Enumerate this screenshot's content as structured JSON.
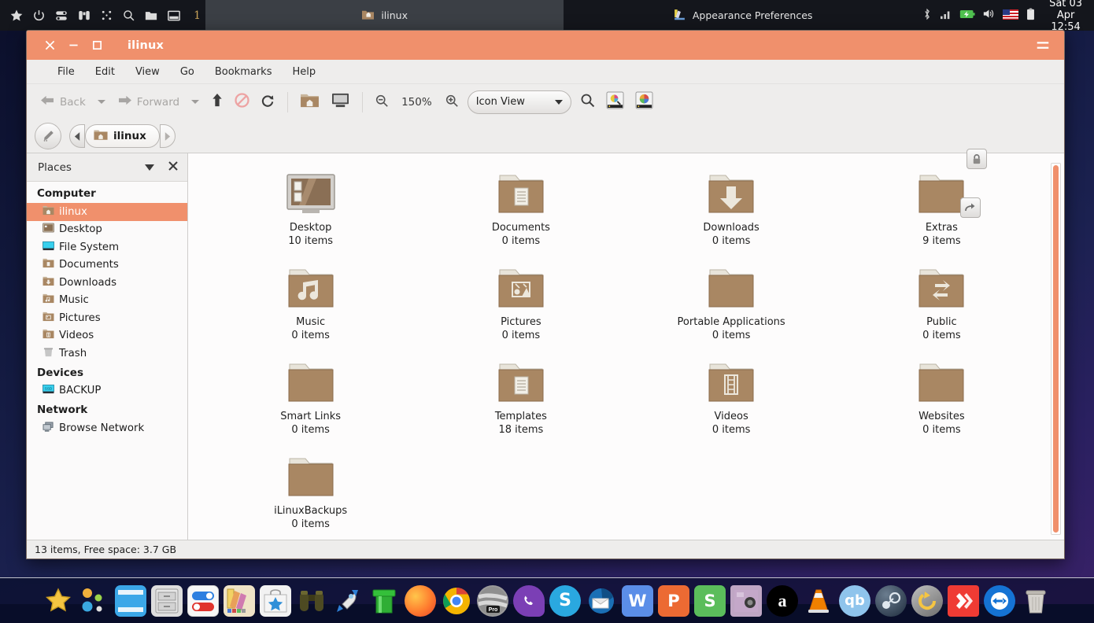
{
  "panel": {
    "launcher_icons": [
      "star-icon",
      "power-icon",
      "switch-user-icon",
      "binoculars-icon",
      "apps-grid-icon",
      "search-icon",
      "folder-icon",
      "window-icon"
    ],
    "workspace": "1",
    "tasks": [
      {
        "label": "ilinux",
        "icon": "home-folder-icon",
        "active": true
      },
      {
        "label": "Appearance Preferences",
        "icon": "appearance-icon",
        "active": false
      }
    ],
    "tray_icons": [
      "bluetooth-icon",
      "signal-icon",
      "battery-icon",
      "volume-icon",
      "flag-us-icon",
      "clipboard-icon"
    ],
    "clock_date": "Sat 03 Apr",
    "clock_time": "12:54"
  },
  "window": {
    "title": "ilinux",
    "close_label": "✕",
    "minimize_label": "—",
    "maximize_label": "□",
    "menu_button": "hamburger-menu-icon",
    "menubar": [
      "File",
      "Edit",
      "View",
      "Go",
      "Bookmarks",
      "Help"
    ],
    "toolbar": {
      "back_label": "Back",
      "forward_label": "Forward",
      "up_icon": "arrow-up-icon",
      "stop_icon": "stop-icon",
      "reload_icon": "reload-icon",
      "home_icon": "home-folder-icon",
      "computer_icon": "computer-icon",
      "zoom_out_icon": "zoom-out-icon",
      "zoom_level": "150%",
      "zoom_in_icon": "zoom-in-icon",
      "view_mode": "Icon View",
      "search_icon": "search-icon",
      "extra_icon_1": "image-search-icon",
      "extra_icon_2": "color-wheel-icon"
    },
    "pathbar": {
      "edit_icon": "pencil-path-icon",
      "prev_icon": "chevron-left-icon",
      "crumb_label": "ilinux",
      "crumb_icon": "home-folder-icon",
      "next_icon": "chevron-right-icon"
    },
    "statusbar": "13 items, Free space: 3.7 GB"
  },
  "sidebar": {
    "header": "Places",
    "header_caret": "chevron-down-icon",
    "header_close": "close-icon",
    "groups": [
      {
        "title": "Computer",
        "items": [
          {
            "label": "ilinux",
            "icon": "home-folder-icon",
            "selected": true
          },
          {
            "label": "Desktop",
            "icon": "desktop-icon",
            "selected": false
          },
          {
            "label": "File System",
            "icon": "drive-icon",
            "selected": false
          },
          {
            "label": "Documents",
            "icon": "documents-folder-icon",
            "selected": false
          },
          {
            "label": "Downloads",
            "icon": "downloads-folder-icon",
            "selected": false
          },
          {
            "label": "Music",
            "icon": "music-folder-icon",
            "selected": false
          },
          {
            "label": "Pictures",
            "icon": "pictures-folder-icon",
            "selected": false
          },
          {
            "label": "Videos",
            "icon": "videos-folder-icon",
            "selected": false
          },
          {
            "label": "Trash",
            "icon": "trash-icon",
            "selected": false
          }
        ]
      },
      {
        "title": "Devices",
        "items": [
          {
            "label": "BACKUP",
            "icon": "ssd-icon",
            "selected": false
          }
        ]
      },
      {
        "title": "Network",
        "items": [
          {
            "label": "Browse Network",
            "icon": "network-icon",
            "selected": false
          }
        ]
      }
    ]
  },
  "files": [
    {
      "name": "Desktop",
      "sub": "10 items",
      "icon": "desktop-monitor-icon",
      "glyph": "desktop",
      "badges": []
    },
    {
      "name": "Documents",
      "sub": "0 items",
      "icon": "documents-folder-icon",
      "glyph": "document",
      "badges": []
    },
    {
      "name": "Downloads",
      "sub": "0 items",
      "icon": "downloads-folder-icon",
      "glyph": "download",
      "badges": []
    },
    {
      "name": "Extras",
      "sub": "9 items",
      "icon": "folder-icon",
      "glyph": "none",
      "badges": [
        "lock-badge",
        "symlink-badge"
      ]
    },
    {
      "name": "Music",
      "sub": "0 items",
      "icon": "music-folder-icon",
      "glyph": "music",
      "badges": []
    },
    {
      "name": "Pictures",
      "sub": "0 items",
      "icon": "pictures-folder-icon",
      "glyph": "picture",
      "badges": []
    },
    {
      "name": "Portable Applications",
      "sub": "0 items",
      "icon": "folder-icon",
      "glyph": "none",
      "badges": []
    },
    {
      "name": "Public",
      "sub": "0 items",
      "icon": "public-folder-icon",
      "glyph": "sync",
      "badges": []
    },
    {
      "name": "Smart Links",
      "sub": "0 items",
      "icon": "folder-icon",
      "glyph": "none",
      "badges": []
    },
    {
      "name": "Templates",
      "sub": "18 items",
      "icon": "templates-folder-icon",
      "glyph": "document",
      "badges": []
    },
    {
      "name": "Videos",
      "sub": "0 items",
      "icon": "videos-folder-icon",
      "glyph": "film",
      "badges": []
    },
    {
      "name": "Websites",
      "sub": "0 items",
      "icon": "folder-icon",
      "glyph": "none",
      "badges": []
    },
    {
      "name": "iLinuxBackups",
      "sub": "0 items",
      "icon": "folder-icon",
      "glyph": "none",
      "badges": []
    }
  ],
  "dock": [
    {
      "name": "menu-launcher",
      "label": "★",
      "bg": "transparent",
      "fg": "#f5c542"
    },
    {
      "name": "app-grid",
      "label": "",
      "bg": "transparent",
      "fg": "#f5c542"
    },
    {
      "name": "file-browser",
      "label": "",
      "bg": "#3ba7e8",
      "fg": "#ffffff"
    },
    {
      "name": "file-cabinet",
      "label": "",
      "bg": "#d8d8d8",
      "fg": "#555555"
    },
    {
      "name": "settings-toggles",
      "label": "",
      "bg": "#f5f5f5",
      "fg": "#2d7fe0"
    },
    {
      "name": "color-palette",
      "label": "",
      "bg": "#ecd9a0",
      "fg": "#444444"
    },
    {
      "name": "software-store",
      "label": "★",
      "bg": "#f0f0f0",
      "fg": "#2f8fd8"
    },
    {
      "name": "binoculars-search",
      "label": "",
      "bg": "#4d4a22",
      "fg": "#c9c48a"
    },
    {
      "name": "rocket-launcher",
      "label": "",
      "bg": "transparent",
      "fg": "#3d8fd6"
    },
    {
      "name": "green-pipe",
      "label": "",
      "bg": "transparent",
      "fg": "#34c03a"
    },
    {
      "name": "firefox",
      "label": "",
      "bg": "#ff7b2e",
      "fg": "#ffffff"
    },
    {
      "name": "google-chrome",
      "label": "",
      "bg": "#ffffff",
      "fg": "#4285f4"
    },
    {
      "name": "opera-pro",
      "label": "Pro",
      "bg": "#9a9a9a",
      "fg": "#ffffff"
    },
    {
      "name": "viber",
      "label": "",
      "bg": "#7b3fb5",
      "fg": "#ffffff"
    },
    {
      "name": "skype",
      "label": "S",
      "bg": "#2aa8e0",
      "fg": "#ffffff"
    },
    {
      "name": "thunderbird",
      "label": "",
      "bg": "#1a6fb5",
      "fg": "#ffffff"
    },
    {
      "name": "writer",
      "label": "W",
      "bg": "#5b8ee8",
      "fg": "#ffffff"
    },
    {
      "name": "impress",
      "label": "P",
      "bg": "#ec6a33",
      "fg": "#ffffff"
    },
    {
      "name": "calc",
      "label": "S",
      "bg": "#5bbd5b",
      "fg": "#ffffff"
    },
    {
      "name": "photo-viewer",
      "label": "",
      "bg": "#b79bbd",
      "fg": "#444444"
    },
    {
      "name": "amazon",
      "label": "a",
      "bg": "#000000",
      "fg": "#ffffff"
    },
    {
      "name": "vlc",
      "label": "",
      "bg": "transparent",
      "fg": "#f08000"
    },
    {
      "name": "qbittorrent",
      "label": "qb",
      "bg": "#8fc4ec",
      "fg": "#ffffff"
    },
    {
      "name": "steam",
      "label": "",
      "bg": "#2a3a52",
      "fg": "#cfd8e0"
    },
    {
      "name": "timeshift",
      "label": "",
      "bg": "#6d6d6d",
      "fg": "#f5c542"
    },
    {
      "name": "anydesk",
      "label": "",
      "bg": "#ef3b34",
      "fg": "#ffffff"
    },
    {
      "name": "teamviewer",
      "label": "",
      "bg": "#1573d4",
      "fg": "#ffffff"
    },
    {
      "name": "trash",
      "label": "",
      "bg": "transparent",
      "fg": "#cfcfcf"
    }
  ],
  "colors": {
    "accent": "#f0906c",
    "panel_bg": "#14161c",
    "window_bg": "#f0efee",
    "folder": "#a98763"
  }
}
